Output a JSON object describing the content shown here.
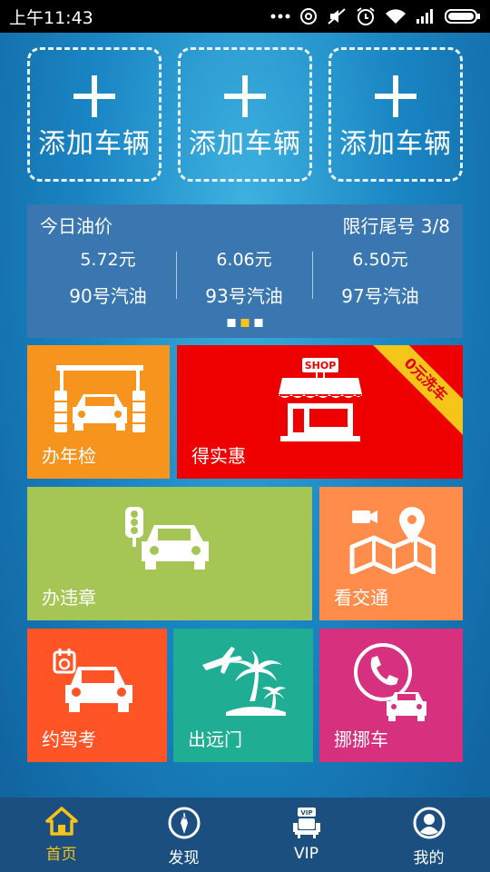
{
  "status_bar": {
    "time": "上午11:43"
  },
  "add_vehicle": {
    "label": "添加车辆"
  },
  "oil_price": {
    "title": "今日油价",
    "restriction": "限行尾号 3/8",
    "items": [
      {
        "price": "5.72元",
        "grade": "90号汽油"
      },
      {
        "price": "6.06元",
        "grade": "93号汽油"
      },
      {
        "price": "6.50元",
        "grade": "97号汽油"
      }
    ]
  },
  "tiles": {
    "inspection": {
      "label": "办年检",
      "color": "#f7941d"
    },
    "deals": {
      "label": "得实惠",
      "color": "#ee0000",
      "shop_sign": "SHOP",
      "ribbon": "0元洗车"
    },
    "violations": {
      "label": "办违章",
      "color": "#a5c655"
    },
    "traffic": {
      "label": "看交通",
      "color": "#ff8c4a"
    },
    "driving_test": {
      "label": "约驾考",
      "color": "#ff5426"
    },
    "travel": {
      "label": "出远门",
      "color": "#1fae94"
    },
    "move_car": {
      "label": "挪挪车",
      "color": "#d7307f"
    }
  },
  "nav": {
    "home": "首页",
    "discover": "发现",
    "vip": "VIP",
    "mine": "我的",
    "vip_badge": "VIP"
  }
}
